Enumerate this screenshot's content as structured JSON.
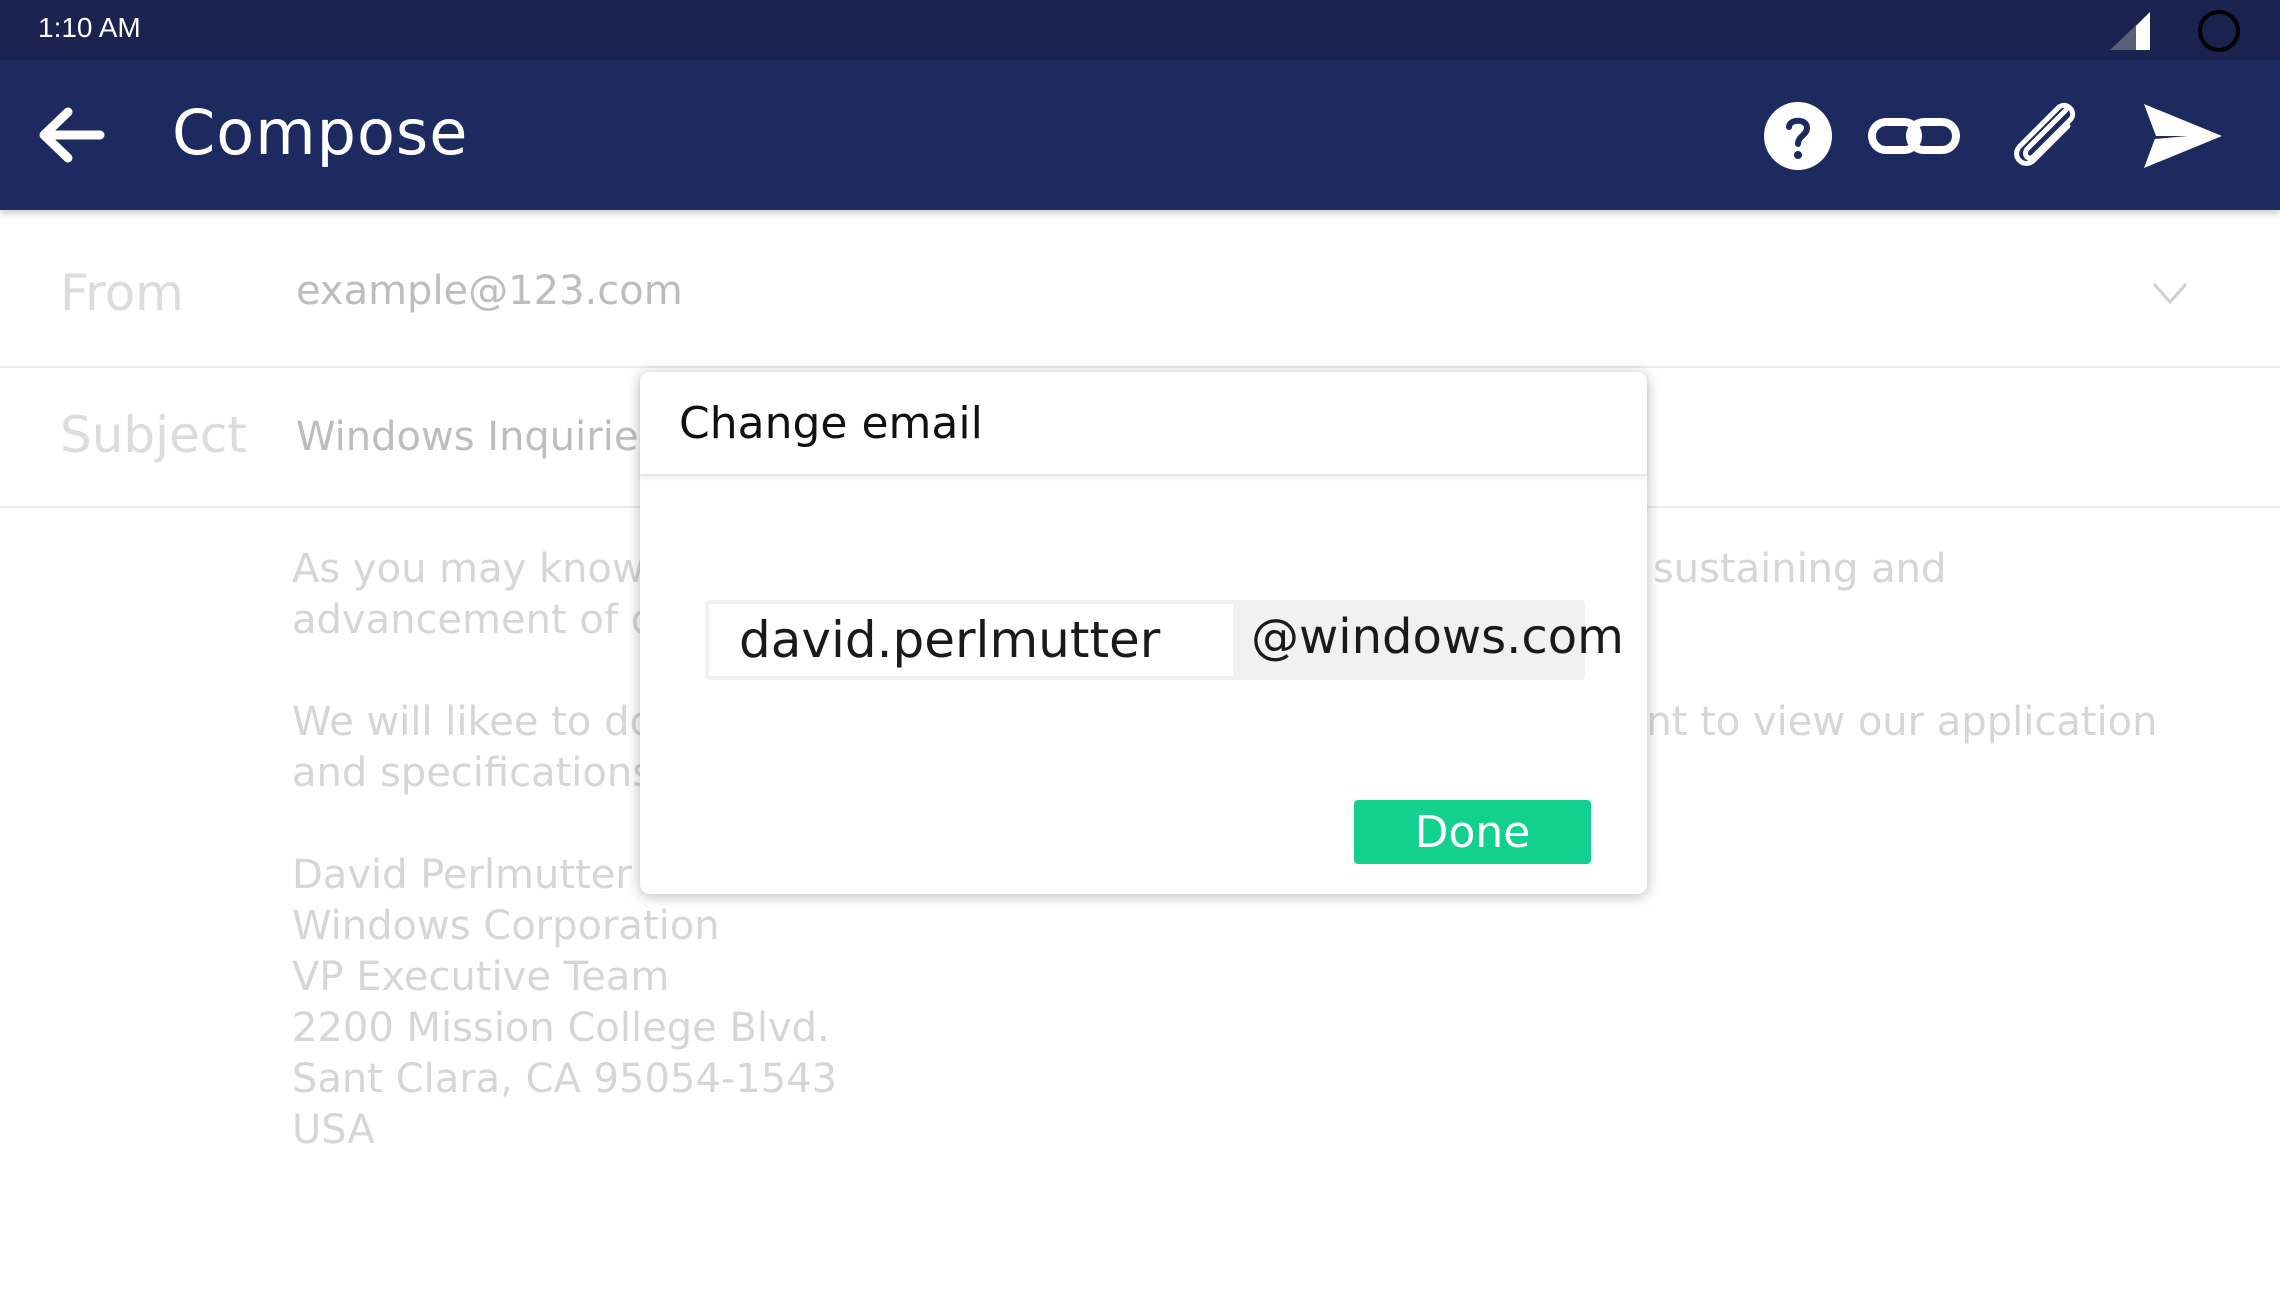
{
  "status_bar": {
    "time": "1:10 AM"
  },
  "app_bar": {
    "title": "Compose",
    "back_icon": "arrow-left-icon",
    "actions": [
      "help-icon",
      "link-icon",
      "paperclip-icon",
      "send-icon"
    ]
  },
  "form": {
    "from_label": "From",
    "from_value": "example@123.com",
    "subject_label": "Subject",
    "subject_value": "Windows Inquiries",
    "body": {
      "paragraph1": "As you may know, our company has been committed to supporting sustaining and advancement of our community.",
      "paragraph2": "We will likee to do business with you. Please kindly check attachment to view our application and specifications.",
      "signature": [
        "David Perlmutter",
        "Windows Corporation",
        "VP Executive Team",
        "2200 Mission College Blvd.",
        "Sant Clara, CA 95054-1543",
        "USA"
      ]
    }
  },
  "modal": {
    "title": "Change email",
    "username": "david.perlmutter",
    "domain": "@windows.com",
    "done_label": "Done"
  },
  "colors": {
    "status_bar": "#1a2350",
    "app_bar": "#1d2a5f",
    "accent_done": "#12d18e"
  }
}
